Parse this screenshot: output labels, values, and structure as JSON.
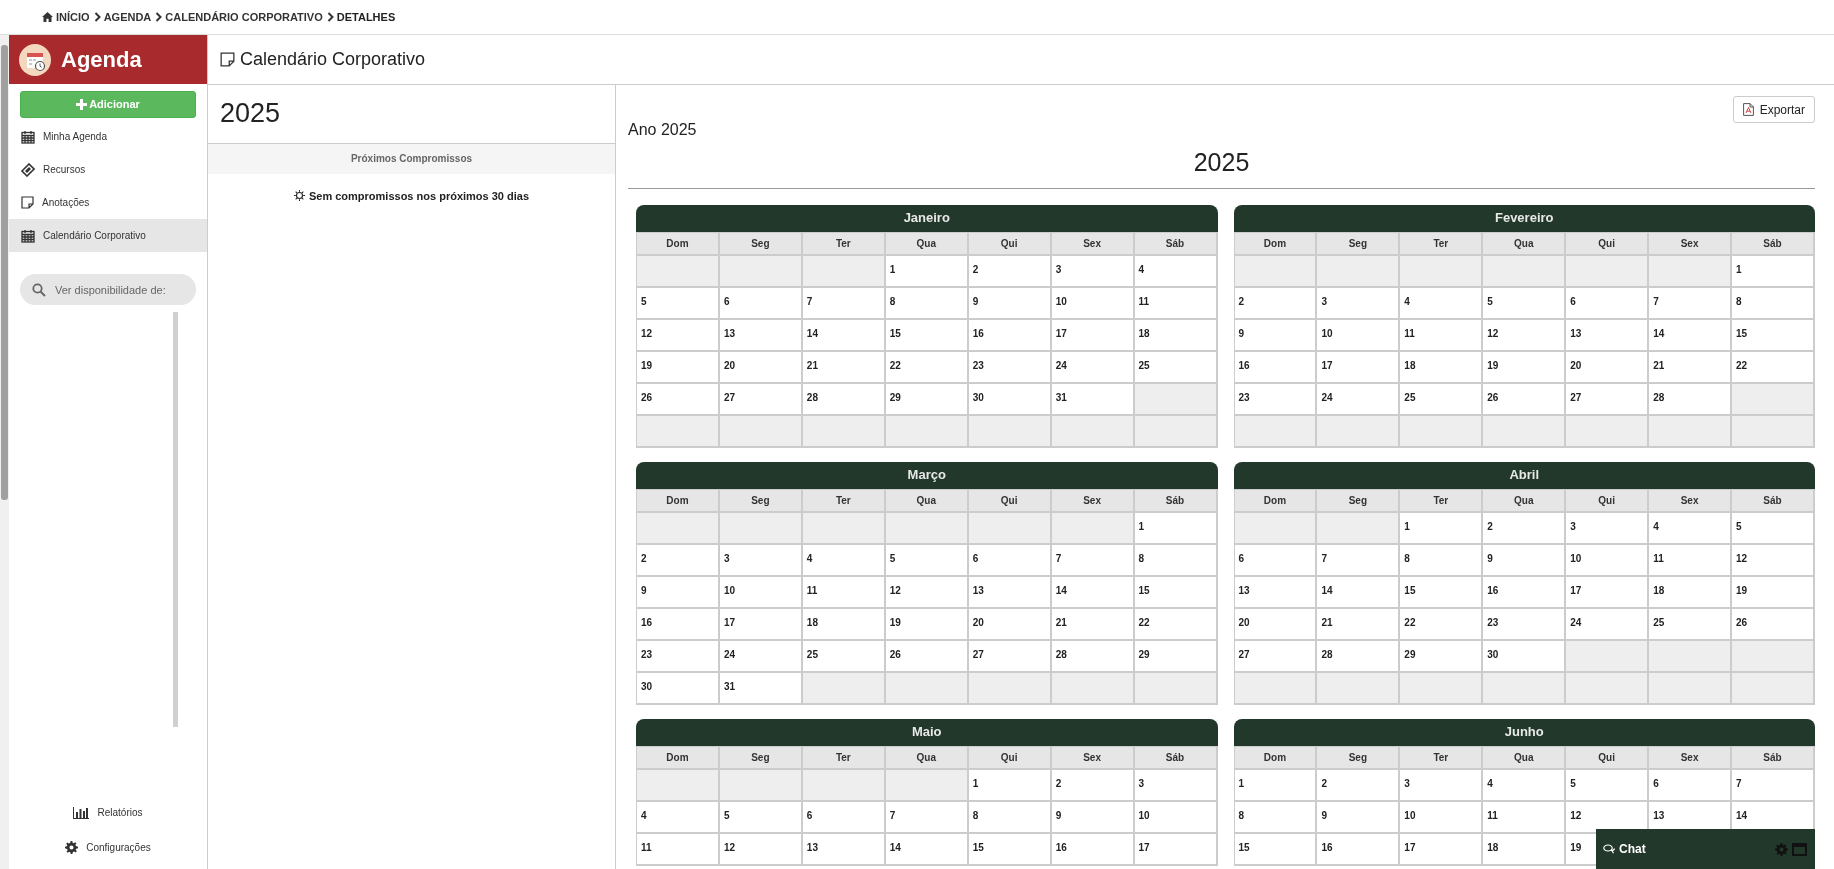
{
  "breadcrumb": [
    {
      "label": "INÍCIO",
      "kind": "home"
    },
    {
      "label": "AGENDA",
      "kind": "link"
    },
    {
      "label": "CALENDÁRIO CORPORATIVO",
      "kind": "link"
    },
    {
      "label": "DETALHES",
      "kind": "current"
    }
  ],
  "sidebar": {
    "title": "Agenda",
    "add_button": "Adicionar",
    "items": [
      {
        "label": "Minha Agenda",
        "kind": "calendar",
        "selected": false
      },
      {
        "label": "Recursos",
        "kind": "tag",
        "selected": false
      },
      {
        "label": "Anotações",
        "kind": "note",
        "selected": false
      },
      {
        "label": "Calendário Corporativo",
        "kind": "calendar",
        "selected": true
      }
    ],
    "search": {
      "placeholder": "Ver disponibilidade de:"
    },
    "footer_items": [
      {
        "label": "Relatórios",
        "kind": "chart"
      },
      {
        "label": "Configurações",
        "kind": "gear"
      }
    ]
  },
  "page_title": "Calendário Corporativo",
  "upcoming": {
    "year": "2025",
    "heading": "Próximos Compromissos",
    "empty_message": "Sem compromissos nos próximos 30 dias"
  },
  "calendar": {
    "export_button": "Exportar",
    "subtitle": "Ano 2025",
    "year": "2025",
    "months": [
      {
        "name": "Janeiro",
        "weekdays": [
          "Dom",
          "Seg",
          "Ter",
          "Qua",
          "Qui",
          "Sex",
          "Sáb"
        ],
        "weeks": [
          [
            {
              "kind": "blank"
            },
            {
              "kind": "blank"
            },
            {
              "kind": "blank"
            },
            {
              "kind": "day",
              "day": "1"
            },
            {
              "kind": "day",
              "day": "2"
            },
            {
              "kind": "day",
              "day": "3"
            },
            {
              "kind": "day",
              "day": "4"
            }
          ],
          [
            {
              "kind": "day",
              "day": "5"
            },
            {
              "kind": "day",
              "day": "6"
            },
            {
              "kind": "day",
              "day": "7"
            },
            {
              "kind": "day",
              "day": "8"
            },
            {
              "kind": "day",
              "day": "9"
            },
            {
              "kind": "day",
              "day": "10"
            },
            {
              "kind": "day",
              "day": "11"
            }
          ],
          [
            {
              "kind": "day",
              "day": "12"
            },
            {
              "kind": "day",
              "day": "13"
            },
            {
              "kind": "day",
              "day": "14"
            },
            {
              "kind": "day",
              "day": "15"
            },
            {
              "kind": "day",
              "day": "16"
            },
            {
              "kind": "day",
              "day": "17"
            },
            {
              "kind": "day",
              "day": "18"
            }
          ],
          [
            {
              "kind": "day",
              "day": "19"
            },
            {
              "kind": "day",
              "day": "20"
            },
            {
              "kind": "day",
              "day": "21"
            },
            {
              "kind": "day",
              "day": "22"
            },
            {
              "kind": "day",
              "day": "23"
            },
            {
              "kind": "day",
              "day": "24"
            },
            {
              "kind": "day",
              "day": "25"
            }
          ],
          [
            {
              "kind": "day",
              "day": "26"
            },
            {
              "kind": "day",
              "day": "27"
            },
            {
              "kind": "day",
              "day": "28"
            },
            {
              "kind": "day",
              "day": "29"
            },
            {
              "kind": "day",
              "day": "30"
            },
            {
              "kind": "day",
              "day": "31"
            },
            {
              "kind": "blank"
            }
          ],
          [
            {
              "kind": "blank"
            },
            {
              "kind": "blank"
            },
            {
              "kind": "blank"
            },
            {
              "kind": "blank"
            },
            {
              "kind": "blank"
            },
            {
              "kind": "blank"
            },
            {
              "kind": "blank"
            }
          ]
        ]
      },
      {
        "name": "Fevereiro",
        "weekdays": [
          "Dom",
          "Seg",
          "Ter",
          "Qua",
          "Qui",
          "Sex",
          "Sáb"
        ],
        "weeks": [
          [
            {
              "kind": "blank"
            },
            {
              "kind": "blank"
            },
            {
              "kind": "blank"
            },
            {
              "kind": "blank"
            },
            {
              "kind": "blank"
            },
            {
              "kind": "blank"
            },
            {
              "kind": "day",
              "day": "1"
            }
          ],
          [
            {
              "kind": "day",
              "day": "2"
            },
            {
              "kind": "day",
              "day": "3"
            },
            {
              "kind": "day",
              "day": "4"
            },
            {
              "kind": "day",
              "day": "5"
            },
            {
              "kind": "day",
              "day": "6"
            },
            {
              "kind": "day",
              "day": "7"
            },
            {
              "kind": "day",
              "day": "8"
            }
          ],
          [
            {
              "kind": "day",
              "day": "9"
            },
            {
              "kind": "day",
              "day": "10"
            },
            {
              "kind": "day",
              "day": "11"
            },
            {
              "kind": "day",
              "day": "12"
            },
            {
              "kind": "day",
              "day": "13"
            },
            {
              "kind": "day",
              "day": "14"
            },
            {
              "kind": "day",
              "day": "15"
            }
          ],
          [
            {
              "kind": "day",
              "day": "16"
            },
            {
              "kind": "day",
              "day": "17"
            },
            {
              "kind": "day",
              "day": "18"
            },
            {
              "kind": "day",
              "day": "19"
            },
            {
              "kind": "day",
              "day": "20"
            },
            {
              "kind": "day",
              "day": "21"
            },
            {
              "kind": "day",
              "day": "22"
            }
          ],
          [
            {
              "kind": "day",
              "day": "23"
            },
            {
              "kind": "day",
              "day": "24"
            },
            {
              "kind": "day",
              "day": "25"
            },
            {
              "kind": "day",
              "day": "26"
            },
            {
              "kind": "day",
              "day": "27"
            },
            {
              "kind": "day",
              "day": "28"
            },
            {
              "kind": "blank"
            }
          ],
          [
            {
              "kind": "blank"
            },
            {
              "kind": "blank"
            },
            {
              "kind": "blank"
            },
            {
              "kind": "blank"
            },
            {
              "kind": "blank"
            },
            {
              "kind": "blank"
            },
            {
              "kind": "blank"
            }
          ]
        ]
      },
      {
        "name": "Março",
        "weekdays": [
          "Dom",
          "Seg",
          "Ter",
          "Qua",
          "Qui",
          "Sex",
          "Sáb"
        ],
        "weeks": [
          [
            {
              "kind": "blank"
            },
            {
              "kind": "blank"
            },
            {
              "kind": "blank"
            },
            {
              "kind": "blank"
            },
            {
              "kind": "blank"
            },
            {
              "kind": "blank"
            },
            {
              "kind": "day",
              "day": "1"
            }
          ],
          [
            {
              "kind": "day",
              "day": "2"
            },
            {
              "kind": "day",
              "day": "3"
            },
            {
              "kind": "day",
              "day": "4"
            },
            {
              "kind": "day",
              "day": "5"
            },
            {
              "kind": "day",
              "day": "6"
            },
            {
              "kind": "day",
              "day": "7"
            },
            {
              "kind": "day",
              "day": "8"
            }
          ],
          [
            {
              "kind": "day",
              "day": "9"
            },
            {
              "kind": "day",
              "day": "10"
            },
            {
              "kind": "day",
              "day": "11"
            },
            {
              "kind": "day",
              "day": "12"
            },
            {
              "kind": "day",
              "day": "13"
            },
            {
              "kind": "day",
              "day": "14"
            },
            {
              "kind": "day",
              "day": "15"
            }
          ],
          [
            {
              "kind": "day",
              "day": "16"
            },
            {
              "kind": "day",
              "day": "17"
            },
            {
              "kind": "day",
              "day": "18"
            },
            {
              "kind": "day",
              "day": "19"
            },
            {
              "kind": "day",
              "day": "20"
            },
            {
              "kind": "day",
              "day": "21"
            },
            {
              "kind": "day",
              "day": "22"
            }
          ],
          [
            {
              "kind": "day",
              "day": "23"
            },
            {
              "kind": "day",
              "day": "24"
            },
            {
              "kind": "day",
              "day": "25"
            },
            {
              "kind": "day",
              "day": "26"
            },
            {
              "kind": "day",
              "day": "27"
            },
            {
              "kind": "day",
              "day": "28"
            },
            {
              "kind": "day",
              "day": "29"
            }
          ],
          [
            {
              "kind": "day",
              "day": "30"
            },
            {
              "kind": "day",
              "day": "31"
            },
            {
              "kind": "blank"
            },
            {
              "kind": "blank"
            },
            {
              "kind": "blank"
            },
            {
              "kind": "blank"
            },
            {
              "kind": "blank"
            }
          ]
        ]
      },
      {
        "name": "Abril",
        "weekdays": [
          "Dom",
          "Seg",
          "Ter",
          "Qua",
          "Qui",
          "Sex",
          "Sáb"
        ],
        "weeks": [
          [
            {
              "kind": "blank"
            },
            {
              "kind": "blank"
            },
            {
              "kind": "day",
              "day": "1"
            },
            {
              "kind": "day",
              "day": "2"
            },
            {
              "kind": "day",
              "day": "3"
            },
            {
              "kind": "day",
              "day": "4"
            },
            {
              "kind": "day",
              "day": "5"
            }
          ],
          [
            {
              "kind": "day",
              "day": "6"
            },
            {
              "kind": "day",
              "day": "7"
            },
            {
              "kind": "day",
              "day": "8"
            },
            {
              "kind": "day",
              "day": "9"
            },
            {
              "kind": "day",
              "day": "10"
            },
            {
              "kind": "day",
              "day": "11"
            },
            {
              "kind": "day",
              "day": "12"
            }
          ],
          [
            {
              "kind": "day",
              "day": "13"
            },
            {
              "kind": "day",
              "day": "14"
            },
            {
              "kind": "day",
              "day": "15"
            },
            {
              "kind": "day",
              "day": "16"
            },
            {
              "kind": "day",
              "day": "17"
            },
            {
              "kind": "day",
              "day": "18"
            },
            {
              "kind": "day",
              "day": "19"
            }
          ],
          [
            {
              "kind": "day",
              "day": "20"
            },
            {
              "kind": "day",
              "day": "21"
            },
            {
              "kind": "day",
              "day": "22"
            },
            {
              "kind": "day",
              "day": "23"
            },
            {
              "kind": "day",
              "day": "24"
            },
            {
              "kind": "day",
              "day": "25"
            },
            {
              "kind": "day",
              "day": "26"
            }
          ],
          [
            {
              "kind": "day",
              "day": "27"
            },
            {
              "kind": "day",
              "day": "28"
            },
            {
              "kind": "day",
              "day": "29"
            },
            {
              "kind": "day",
              "day": "30"
            },
            {
              "kind": "blank"
            },
            {
              "kind": "blank"
            },
            {
              "kind": "blank"
            }
          ],
          [
            {
              "kind": "blank"
            },
            {
              "kind": "blank"
            },
            {
              "kind": "blank"
            },
            {
              "kind": "blank"
            },
            {
              "kind": "blank"
            },
            {
              "kind": "blank"
            },
            {
              "kind": "blank"
            }
          ]
        ]
      },
      {
        "name": "Maio",
        "weekdays": [
          "Dom",
          "Seg",
          "Ter",
          "Qua",
          "Qui",
          "Sex",
          "Sáb"
        ],
        "weeks": [
          [
            {
              "kind": "blank"
            },
            {
              "kind": "blank"
            },
            {
              "kind": "blank"
            },
            {
              "kind": "blank"
            },
            {
              "kind": "day",
              "day": "1"
            },
            {
              "kind": "day",
              "day": "2"
            },
            {
              "kind": "day",
              "day": "3"
            }
          ],
          [
            {
              "kind": "day",
              "day": "4"
            },
            {
              "kind": "day",
              "day": "5"
            },
            {
              "kind": "day",
              "day": "6"
            },
            {
              "kind": "day",
              "day": "7"
            },
            {
              "kind": "day",
              "day": "8"
            },
            {
              "kind": "day",
              "day": "9"
            },
            {
              "kind": "day",
              "day": "10"
            }
          ],
          [
            {
              "kind": "day",
              "day": "11"
            },
            {
              "kind": "day",
              "day": "12"
            },
            {
              "kind": "day",
              "day": "13"
            },
            {
              "kind": "day",
              "day": "14"
            },
            {
              "kind": "day",
              "day": "15"
            },
            {
              "kind": "day",
              "day": "16"
            },
            {
              "kind": "day",
              "day": "17"
            }
          ]
        ]
      },
      {
        "name": "Junho",
        "weekdays": [
          "Dom",
          "Seg",
          "Ter",
          "Qua",
          "Qui",
          "Sex",
          "Sáb"
        ],
        "weeks": [
          [
            {
              "kind": "day",
              "day": "1"
            },
            {
              "kind": "day",
              "day": "2"
            },
            {
              "kind": "day",
              "day": "3"
            },
            {
              "kind": "day",
              "day": "4"
            },
            {
              "kind": "day",
              "day": "5"
            },
            {
              "kind": "day",
              "day": "6"
            },
            {
              "kind": "day",
              "day": "7"
            }
          ],
          [
            {
              "kind": "day",
              "day": "8"
            },
            {
              "kind": "day",
              "day": "9"
            },
            {
              "kind": "day",
              "day": "10"
            },
            {
              "kind": "day",
              "day": "11"
            },
            {
              "kind": "day",
              "day": "12"
            },
            {
              "kind": "day",
              "day": "13"
            },
            {
              "kind": "day",
              "day": "14"
            }
          ],
          [
            {
              "kind": "day",
              "day": "15"
            },
            {
              "kind": "day",
              "day": "16"
            },
            {
              "kind": "day",
              "day": "17"
            },
            {
              "kind": "day",
              "day": "18"
            },
            {
              "kind": "day",
              "day": "19"
            }
          ]
        ]
      }
    ]
  },
  "chat": {
    "label": "Chat"
  }
}
